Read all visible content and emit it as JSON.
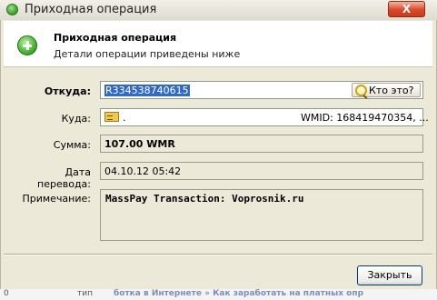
{
  "window": {
    "title": "Приходная операция",
    "close_label": "X"
  },
  "header": {
    "title": "Приходная операция",
    "subtitle": "Детали операции приведены ниже"
  },
  "fields": {
    "from": {
      "label": "Откуда:",
      "value": "R334538740615",
      "whois_label": "Кто это?"
    },
    "to": {
      "label": "Куда:",
      "value": ".",
      "wmid": "WMID: 168419470354, ..."
    },
    "amount": {
      "label": "Сумма:",
      "value": "107.00 WMR"
    },
    "date": {
      "label": "Дата перевода:",
      "value": "04.10.12 05:42"
    },
    "note": {
      "label": "Примечание:",
      "value": "MassPay Transaction: Voprosnik.ru"
    }
  },
  "buttons": {
    "close": "Закрыть"
  },
  "background": {
    "left": "0",
    "mid": "тип",
    "link": "ботка в Интернете » Как заработать на платных опр"
  },
  "icons": {
    "title": "add-green-icon",
    "header": "add-green-icon",
    "whois": "magnifier-user-icon",
    "wallet": "wallet-icon"
  }
}
